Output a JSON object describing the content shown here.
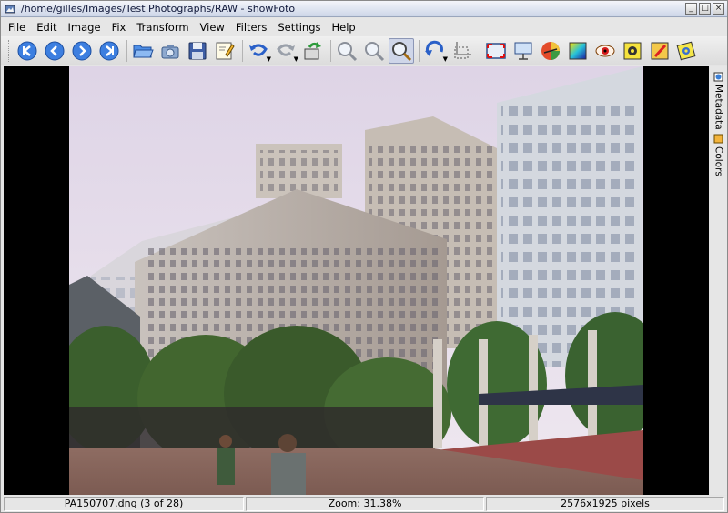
{
  "window": {
    "title": "/home/gilles/Images/Test Photographs/RAW - showFoto",
    "buttons": {
      "minimize": "_",
      "maximize": "□",
      "close": "×"
    }
  },
  "menu": {
    "items": [
      "File",
      "Edit",
      "Image",
      "Fix",
      "Transform",
      "View",
      "Filters",
      "Settings",
      "Help"
    ]
  },
  "toolbar": {
    "buttons": [
      {
        "name": "first-image",
        "icon": "go-first-icon"
      },
      {
        "name": "previous-image",
        "icon": "go-previous-icon"
      },
      {
        "name": "next-image",
        "icon": "go-next-icon"
      },
      {
        "name": "last-image",
        "icon": "go-last-icon"
      },
      {
        "name": "open-file",
        "icon": "folder-open-icon"
      },
      {
        "name": "open-folder",
        "icon": "camera-folder-icon"
      },
      {
        "name": "save",
        "icon": "floppy-disk-icon"
      },
      {
        "name": "save-as",
        "icon": "save-as-icon"
      },
      {
        "name": "undo",
        "icon": "undo-icon",
        "dropdown": true
      },
      {
        "name": "redo",
        "icon": "redo-icon",
        "dropdown": true
      },
      {
        "name": "revert",
        "icon": "revert-icon"
      },
      {
        "name": "zoom-in",
        "icon": "zoom-in-icon"
      },
      {
        "name": "zoom-out",
        "icon": "zoom-out-icon"
      },
      {
        "name": "zoom-fit",
        "icon": "zoom-fit-icon",
        "active": true
      },
      {
        "name": "rotate",
        "icon": "rotate-icon",
        "dropdown": true
      },
      {
        "name": "crop",
        "icon": "crop-icon"
      },
      {
        "name": "full-screen",
        "icon": "fullscreen-icon"
      },
      {
        "name": "slideshow",
        "icon": "slideshow-icon"
      },
      {
        "name": "color-balance",
        "icon": "color-balance-icon"
      },
      {
        "name": "levels",
        "icon": "levels-icon"
      },
      {
        "name": "red-eye",
        "icon": "red-eye-icon"
      },
      {
        "name": "sharpen",
        "icon": "sharpen-icon"
      },
      {
        "name": "restoration",
        "icon": "restoration-icon"
      },
      {
        "name": "insert-text",
        "icon": "film-icon"
      }
    ]
  },
  "sidebar": {
    "tabs": [
      {
        "label": "Metadata",
        "icon": "metadata-icon"
      },
      {
        "label": "Colors",
        "icon": "colors-icon"
      }
    ]
  },
  "image": {
    "description_icon": "photo-canvas"
  },
  "status": {
    "filename": "PA150707.dng (3 of 28)",
    "zoom": "Zoom: 31.38%",
    "dimensions": "2576x1925 pixels"
  },
  "colors": {
    "accent": "#2b6fd6",
    "canvas_bg": "#000000"
  }
}
